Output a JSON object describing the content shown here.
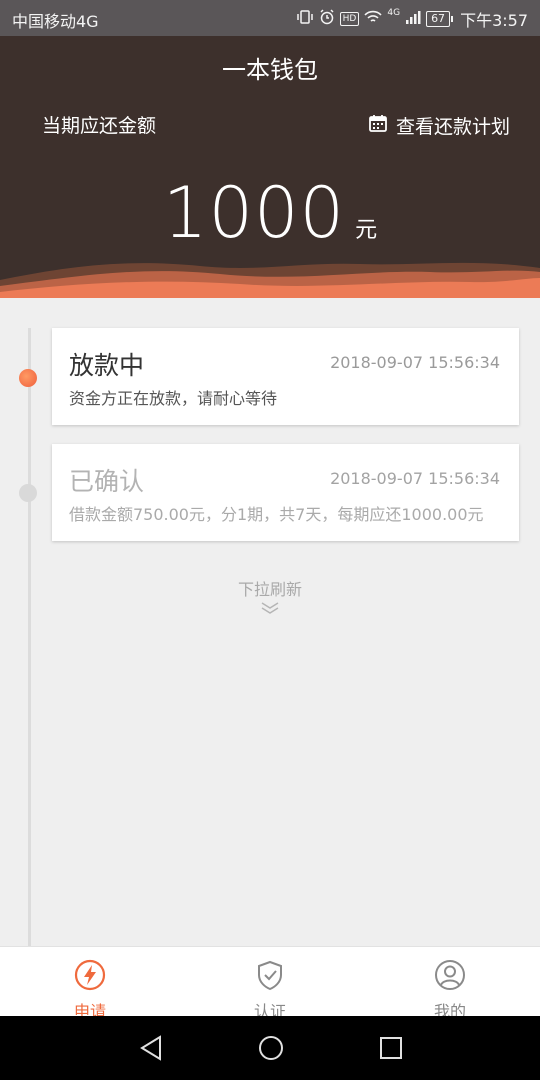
{
  "status_bar": {
    "carrier": "中国移动4G",
    "hd_label": "HD",
    "network_label": "4G",
    "battery": "67",
    "time": "下午3:57"
  },
  "header": {
    "app_title": "一本钱包",
    "due_label": "当期应还金额",
    "plan_link": "查看还款计划",
    "amount": "1000",
    "unit": "元"
  },
  "timeline": [
    {
      "title": "放款中",
      "time": "2018-09-07 15:56:34",
      "desc": "资金方正在放款，请耐心等待",
      "active": true
    },
    {
      "title": "已确认",
      "time": "2018-09-07 15:56:34",
      "desc": "借款金额750.00元，分1期，共7天，每期应还1000.00元",
      "active": false
    }
  ],
  "refresh_hint": "下拉刷新",
  "tabs": [
    {
      "label": "申请",
      "icon": "lightning-icon",
      "active": true
    },
    {
      "label": "认证",
      "icon": "shield-check-icon",
      "active": false
    },
    {
      "label": "我的",
      "icon": "user-icon",
      "active": false
    }
  ],
  "colors": {
    "header_bg": "#3d302c",
    "accent": "#ef6a3d",
    "page_bg": "#efefef"
  }
}
